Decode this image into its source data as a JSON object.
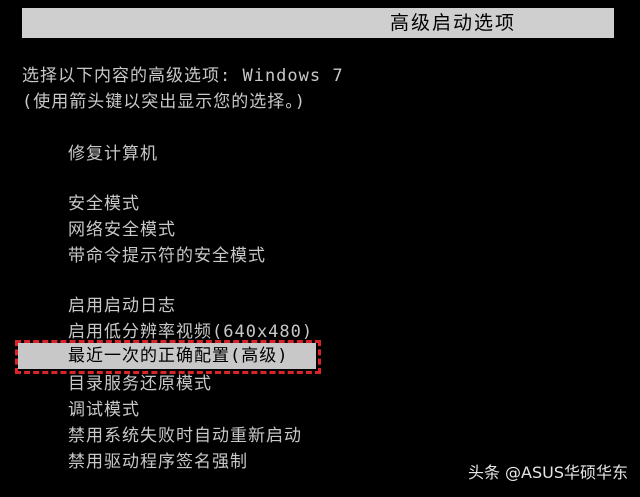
{
  "header": {
    "title": "高级启动选项"
  },
  "prompt": {
    "line1": "选择以下内容的高级选项: Windows 7",
    "line2": "(使用箭头键以突出显示您的选择。)"
  },
  "menu": {
    "repair": "修复计算机",
    "safe_mode": "安全模式",
    "safe_mode_network": "网络安全模式",
    "safe_mode_cmd": "带命令提示符的安全模式",
    "boot_logging": "启用启动日志",
    "low_res_video": "启用低分辨率视频(640x480)",
    "last_known_good": "最近一次的正确配置(高级)",
    "ds_restore": "目录服务还原模式",
    "debugging": "调试模式",
    "disable_auto_restart": "禁用系统失败时自动重新启动",
    "disable_driver_signature": "禁用驱动程序签名强制"
  },
  "watermark": {
    "text": "头条 @ASUS华硕华东"
  },
  "colors": {
    "background": "#000000",
    "text": "#c8c8c8",
    "highlight_bg": "#c8c8c8",
    "highlight_frame": "#d9252a"
  }
}
